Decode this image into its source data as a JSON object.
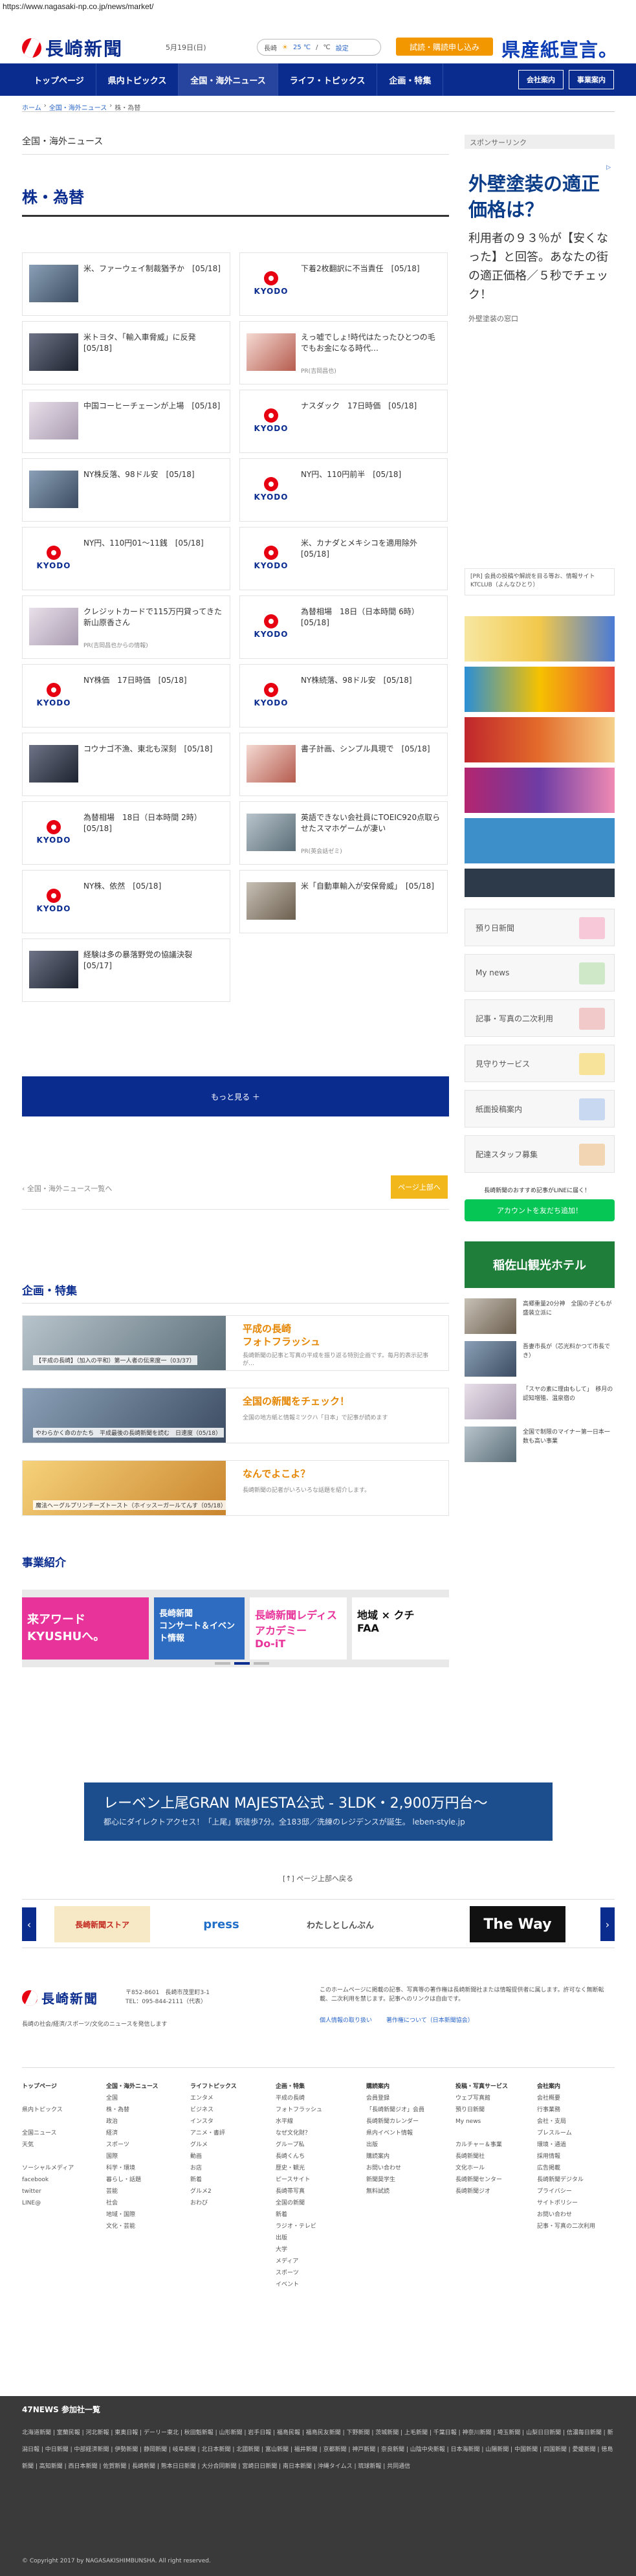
{
  "browser": {
    "url": "https://www.nagasaki-np.co.jp/news/market/"
  },
  "header": {
    "logo_text": "長崎新聞",
    "date": "5月19日(日)",
    "weather": {
      "region": "長崎",
      "temp": "25 ℃",
      "sep": "/",
      "low": "℃",
      "link": "設定"
    },
    "trial_button": "試読・購読申し込み",
    "ad_brand": "県産紙宣言。"
  },
  "nav": {
    "items": [
      "トップページ",
      "県内トピックス",
      "全国・海外ニュース",
      "ライフ・トピックス",
      "企画・特集"
    ],
    "active_index": 2,
    "right": [
      "会社案内",
      "事業案内"
    ]
  },
  "breadcrumb": [
    "ホーム",
    "全国・海外ニュース",
    "株・為替"
  ],
  "main": {
    "section_heading": "全国・海外ニュース",
    "category_title": "株・為替",
    "articles": [
      {
        "title": "米、ファーウェイ制裁猶予か　[05/18]",
        "thumb": "photo"
      },
      {
        "title": "下着2枚翻訳に不当責任　[05/18]",
        "thumb": "kyodo"
      },
      {
        "title": "米トヨタ、「輸入車脅威」に反発　[05/18]",
        "thumb": "photo"
      },
      {
        "title": "えっ嘘でしょ!時代はたったひとつの毛でもお金になる時代…",
        "pr": "PR(吉岡昌也)",
        "thumb": "photo"
      },
      {
        "title": "中国コーヒーチェーンが上場　[05/18]",
        "thumb": "photo"
      },
      {
        "title": "ナスダック　17日時価　[05/18]",
        "thumb": "kyodo"
      },
      {
        "title": "NY株反落、98ドル安　[05/18]",
        "thumb": "photo"
      },
      {
        "title": "NY円、110円前半　[05/18]",
        "thumb": "kyodo"
      },
      {
        "title": "NY円、110円01〜11銭　[05/18]",
        "thumb": "kyodo"
      },
      {
        "title": "米、カナダとメキシコを適用除外　[05/18]",
        "thumb": "kyodo"
      },
      {
        "title": "クレジットカードで115万円貸ってきた新山原香さん",
        "pr": "PR(吉岡昌也からの情報)",
        "thumb": "photo"
      },
      {
        "title": "為替相場　18日（日本時間 6時）　[05/18]",
        "thumb": "kyodo"
      },
      {
        "title": "NY株価　17日時価　[05/18]",
        "thumb": "kyodo"
      },
      {
        "title": "NY株続落、98ドル安　[05/18]",
        "thumb": "kyodo"
      },
      {
        "title": "コウナゴ不漁、東北も深刻　[05/18]",
        "thumb": "photo"
      },
      {
        "title": "書子計画、シンプル具現で　[05/18]",
        "thumb": "photo"
      },
      {
        "title": "為替相場　18日（日本時間 2時）　[05/18]",
        "thumb": "kyodo"
      },
      {
        "title": "英語できない会社員にTOEIC920点取らせたスマホゲームが凄い",
        "pr": "PR(英会話ゼミ)",
        "thumb": "photo"
      },
      {
        "title": "NY株、依然　[05/18]",
        "thumb": "kyodo"
      },
      {
        "title": "米「自動車輸入が安保脅威」　[05/18]",
        "thumb": "photo"
      },
      {
        "title": "経験は多の暴落野党の協議決裂　[05/17]",
        "thumb": "photo"
      }
    ],
    "more_button": "もっと見る ＋",
    "back_link": "全国・海外ニュース一覧へ",
    "page_top": "ページ上部へ"
  },
  "sidebar": {
    "sponsor_heading": "スポンサーリンク",
    "ad_copy": "外壁塗装の適正価格は？",
    "ad_body": "利用者の９３％が【安くなった】と回答。あなたの街の適正価格／５秒でチェック！",
    "ad_source": "外壁塗装の窓口",
    "note": "[PR] 会員の投稿や解説を目る等お、情報サイト KTCLUB（よんなひとり）",
    "services": [
      "預り日新聞",
      "My news",
      "記事・写真の二次利用",
      "見守りサービス",
      "紙面投稿案内",
      "配達スタッフ募集"
    ],
    "line_label": "長崎新聞のおすすめ記事がLINEに届く！",
    "line_button": "アカウントを友だち追加！",
    "hotel": "稲佐山観光ホテル",
    "side_items": [
      "高郷重量20分神　全国の子どもが盛装立派に",
      "吾妻市長が（芯光料かつて市長でき）",
      "「スヤの素に理由もして」　移月の認知増殖、温泉宿の",
      "全国で制限のマイナー第一日本一数も高い事業"
    ]
  },
  "features": {
    "title": "企画・特集",
    "items": [
      {
        "caption": "【平成の長崎】（加入の平和）第一人者の伝来度一（03/37）",
        "heading": "平成の長崎\nフォトフラッシュ",
        "desc": "長崎新聞の記事と写真の平成を振り返る特別企画です。毎月的表示記事が…"
      },
      {
        "caption": "やわらかく命のかたち　平成最後の長崎新聞を読む　日速度（05/18）",
        "heading": "全国の新聞をチェック！",
        "desc": "全国の地方紙と情報ミツクハ「日本」で記事が読めます"
      },
      {
        "caption": "魔法ヘーグルプリンチーズトースト（ホイッスーガールてんす（05/18）",
        "heading": "なんでよこよ？",
        "desc": "長崎新聞の記者がいろいろな話題を紹介します。"
      }
    ]
  },
  "business": {
    "title": "事業紹介",
    "slides": [
      "来アワード　KYUSHUへ。",
      "長崎新聞\nコンサート＆イベント情報",
      "長崎新聞レディスアカデミー\nDo-iT",
      "地域 × クチ\nFAA"
    ]
  },
  "bottom_ad": {
    "title": "レーベン上尾GRAN MAJESTA公式 - 3LDK・2,900万円台～",
    "sub": "都心にダイレクトアクセス！「上尾」駅徒歩7分。全183邸／洗練のレジデンスが誕生。 leben-style.jp"
  },
  "page_top2": "[↑] ページ上部へ戻る",
  "logos": [
    "長崎新聞ストア",
    "press",
    "わたしとしんぶん",
    "The Way"
  ],
  "footer": {
    "logo_text": "長崎新聞",
    "address": "〒852-8601　長崎市茂里町3-1\nTEL：095-844-2111（代表）",
    "desc": "長崎の社会/経済/スポーツ/文化のニュースを発信します",
    "copyright_note": "このホームページに掲載の記事、写真等の著作権は長崎新聞社または情報提供者に属します。許可なく無断転載、二次利用を禁じます。記事へのリンクは自由です。",
    "links": [
      "個人情報の取り扱い",
      "著作権について（日本新聞協会）"
    ],
    "cols": [
      {
        "h": "トップページ",
        "items": [
          "",
          "県内トピックス",
          "",
          "全国ニュース",
          "天気",
          "",
          "ソーシャルメディア",
          "facebook",
          "twitter",
          "LINE@"
        ]
      },
      {
        "h": "全国・海外ニュース",
        "items": [
          "全国",
          "株・為替",
          "政治",
          "経済",
          "スポーツ",
          "国際",
          "科学・環境",
          "暮らし・話題",
          "芸能",
          "社会",
          "地域・国際",
          "文化・芸能"
        ]
      },
      {
        "h": "ライフトピックス",
        "items": [
          "エンタメ",
          "ビジネス",
          "インスタ",
          "アニメ・書評",
          "グルメ",
          "動画",
          "お店",
          "新着",
          "グルメ2",
          "おわび"
        ]
      },
      {
        "h": "企画・特集",
        "items": [
          "平成の長崎",
          "フォトフラッシュ",
          "水平線",
          "なぜ文化財？",
          "グループ私",
          "長崎くんち",
          "歴史・観光",
          "ピースサイト",
          "長崎帯写真",
          "全国の新聞",
          "新着",
          "ラジオ・テレビ",
          "出版",
          "大学",
          "メディア",
          "スポーツ",
          "イベント"
        ]
      },
      {
        "h": "購読案内",
        "items": [
          "会員登録",
          "「長崎新聞ジオ」会員",
          "長崎新聞カレンダー",
          "県内イベント情報",
          "出版",
          "購読案内",
          "お問い合わせ",
          "新聞奨学生",
          "無料試読"
        ]
      },
      {
        "h": "投稿・写真サービス",
        "items": [
          "ウェブ写真館",
          "預り日新聞",
          "My news",
          "",
          "カルチャー＆事業",
          "長崎新聞社",
          "文化ホール",
          "長崎新聞センター",
          "長崎新聞ジオ"
        ]
      },
      {
        "h": "会社案内",
        "items": [
          "会社概要",
          "行事業務",
          "会社・支局",
          "プレスルーム",
          "環境・通過",
          "採用情報",
          "広告掲載",
          "長崎新聞デジタル",
          "プライバシー",
          "サイトポリシー",
          "お問い合わせ",
          "記事・写真の二次利用"
        ]
      }
    ]
  },
  "n47": {
    "heading": "47NEWS 参加社一覧",
    "links": "北海道新聞 | 室蘭民報 | 河北新報 | 東奥日報 | デーリー東北 | 秋田魁新報 | 山形新聞 | 岩手日報 | 福島民報 | 福島民友新聞 | 下野新聞 | 茨城新聞 | 上毛新聞 | 千葉日報 | 神奈川新聞 | 埼玉新聞 | 山梨日日新聞 | 信濃毎日新聞 | 新潟日報 | 中日新聞 | 中部経済新聞 | 伊勢新聞 | 静岡新聞 | 岐阜新聞 | 北日本新聞 | 北國新聞 | 富山新聞 | 福井新聞 | 京都新聞 | 神戸新聞 | 奈良新聞 | 山陰中央新報 | 日本海新聞 | 山陽新聞 | 中国新聞 | 四国新聞 | 愛媛新聞 | 徳島新聞 | 高知新聞 | 西日本新聞 | 佐賀新聞 | 長崎新聞 | 熊本日日新聞 | 大分合同新聞 | 宮崎日日新聞 | 南日本新聞 | 沖縄タイムス | 琉球新報 | 共同通信",
    "copyright": "© Copyright 2017 by NAGASAKISHIMBUNSHA. All right reserved."
  }
}
